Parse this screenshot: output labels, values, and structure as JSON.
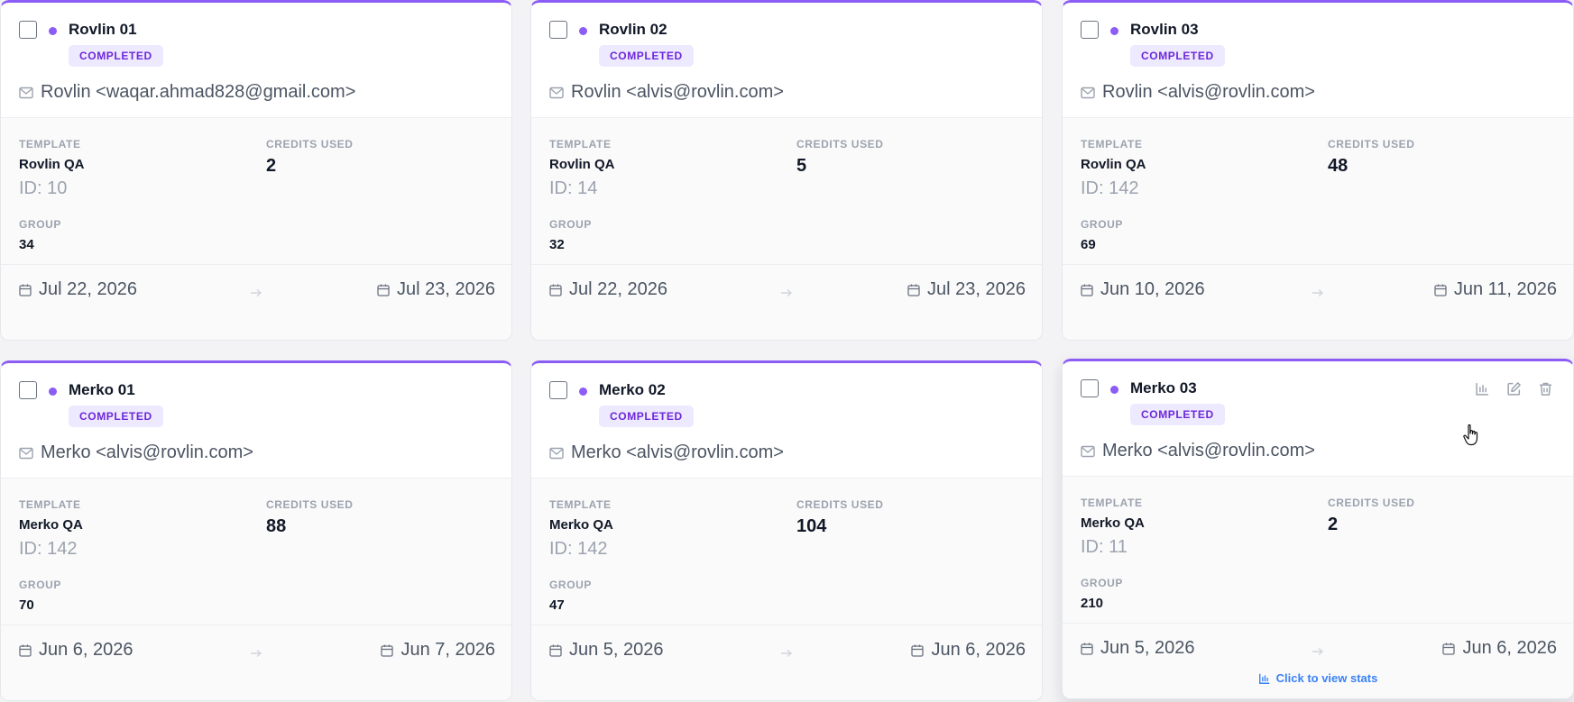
{
  "labels": {
    "template": "TEMPLATE",
    "credits_used": "CREDITS USED",
    "group": "GROUP"
  },
  "cards": [
    {
      "name": "Rovlin 01",
      "status": "COMPLETED",
      "sender": "Rovlin <waqar.ahmad828@gmail.com>",
      "template": "Rovlin QA",
      "template_id": "ID: 10",
      "credits_used": "2",
      "group": "34",
      "start_date": "Jul 22, 2026",
      "end_date": "Jul 23, 2026"
    },
    {
      "name": "Rovlin 02",
      "status": "COMPLETED",
      "sender": "Rovlin <alvis@rovlin.com>",
      "template": "Rovlin QA",
      "template_id": "ID: 14",
      "credits_used": "5",
      "group": "32",
      "start_date": "Jul 22, 2026",
      "end_date": "Jul 23, 2026"
    },
    {
      "name": "Rovlin 03",
      "status": "COMPLETED",
      "sender": "Rovlin <alvis@rovlin.com>",
      "template": "Rovlin QA",
      "template_id": "ID: 142",
      "credits_used": "48",
      "group": "69",
      "start_date": "Jun 10, 2026",
      "end_date": "Jun 11, 2026"
    },
    {
      "name": "Merko 01",
      "status": "COMPLETED",
      "sender": "Merko <alvis@rovlin.com>",
      "template": "Merko QA",
      "template_id": "ID: 142",
      "credits_used": "88",
      "group": "70",
      "start_date": "Jun 6, 2026",
      "end_date": "Jun 7, 2026"
    },
    {
      "name": "Merko 02",
      "status": "COMPLETED",
      "sender": "Merko <alvis@rovlin.com>",
      "template": "Merko QA",
      "template_id": "ID: 142",
      "credits_used": "104",
      "group": "47",
      "start_date": "Jun 5, 2026",
      "end_date": "Jun 6, 2026"
    },
    {
      "name": "Merko 03",
      "status": "COMPLETED",
      "sender": "Merko <alvis@rovlin.com>",
      "template": "Merko QA",
      "template_id": "ID: 11",
      "credits_used": "2",
      "group": "210",
      "start_date": "Jun 5, 2026",
      "end_date": "Jun 6, 2026",
      "stats_link": "Click to view stats"
    }
  ],
  "colors": {
    "accent": "#8b5cf6",
    "badge_bg": "#ede9fe",
    "badge_text": "#6d28d9",
    "link": "#3b82f6"
  },
  "icons": {
    "sender": "mail-icon",
    "date": "calendar-icon",
    "range": "arrow-right-icon",
    "actions": [
      "bar-chart-icon",
      "edit-icon",
      "trash-icon"
    ]
  }
}
